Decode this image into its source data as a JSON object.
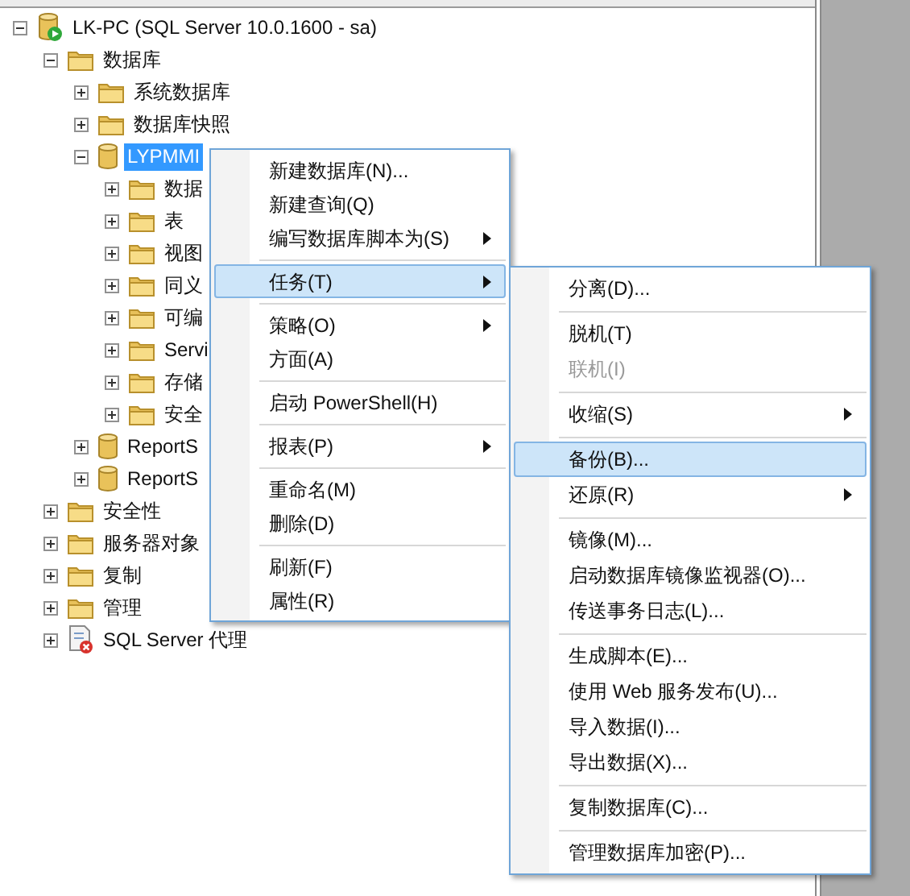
{
  "tree": [
    {
      "label": "LK-PC (SQL Server 10.0.1600 - sa)",
      "kind": "server",
      "expanded": true,
      "selected": false,
      "children": [
        {
          "label": "数据库",
          "kind": "folder",
          "expanded": true,
          "selected": false,
          "children": [
            {
              "label": "系统数据库",
              "kind": "folder",
              "expanded": false,
              "selected": false
            },
            {
              "label": "数据库快照",
              "kind": "folder",
              "expanded": false,
              "selected": false
            },
            {
              "label": "LYPMMI",
              "kind": "database",
              "expanded": true,
              "selected": true,
              "children": [
                {
                  "label": "数据",
                  "kind": "folder",
                  "expanded": false,
                  "selected": false
                },
                {
                  "label": "表",
                  "kind": "folder",
                  "expanded": false,
                  "selected": false
                },
                {
                  "label": "视图",
                  "kind": "folder",
                  "expanded": false,
                  "selected": false
                },
                {
                  "label": "同义",
                  "kind": "folder",
                  "expanded": false,
                  "selected": false
                },
                {
                  "label": "可编",
                  "kind": "folder",
                  "expanded": false,
                  "selected": false
                },
                {
                  "label": "Servi",
                  "kind": "folder",
                  "expanded": false,
                  "selected": false
                },
                {
                  "label": "存储",
                  "kind": "folder",
                  "expanded": false,
                  "selected": false
                },
                {
                  "label": "安全",
                  "kind": "folder",
                  "expanded": false,
                  "selected": false
                }
              ]
            },
            {
              "label": "ReportS",
              "kind": "database",
              "expanded": false,
              "selected": false
            },
            {
              "label": "ReportS",
              "kind": "database",
              "expanded": false,
              "selected": false
            }
          ]
        },
        {
          "label": "安全性",
          "kind": "folder",
          "expanded": false,
          "selected": false
        },
        {
          "label": "服务器对象",
          "kind": "folder",
          "expanded": false,
          "selected": false
        },
        {
          "label": "复制",
          "kind": "folder",
          "expanded": false,
          "selected": false
        },
        {
          "label": "管理",
          "kind": "folder",
          "expanded": false,
          "selected": false
        },
        {
          "label": "SQL Server 代理",
          "kind": "agent",
          "expanded": false,
          "selected": false
        }
      ]
    }
  ],
  "context_menu": {
    "items": [
      {
        "kind": "item",
        "label": "新建数据库(N)...",
        "submenu": false,
        "selected": false,
        "disabled": false
      },
      {
        "kind": "item",
        "label": "新建查询(Q)",
        "submenu": false,
        "selected": false,
        "disabled": false
      },
      {
        "kind": "item",
        "label": "编写数据库脚本为(S)",
        "submenu": true,
        "selected": false,
        "disabled": false
      },
      {
        "kind": "separator"
      },
      {
        "kind": "item",
        "label": "任务(T)",
        "submenu": true,
        "selected": true,
        "disabled": false
      },
      {
        "kind": "separator"
      },
      {
        "kind": "item",
        "label": "策略(O)",
        "submenu": true,
        "selected": false,
        "disabled": false
      },
      {
        "kind": "item",
        "label": "方面(A)",
        "submenu": false,
        "selected": false,
        "disabled": false
      },
      {
        "kind": "separator"
      },
      {
        "kind": "item",
        "label": "启动 PowerShell(H)",
        "submenu": false,
        "selected": false,
        "disabled": false
      },
      {
        "kind": "separator"
      },
      {
        "kind": "item",
        "label": "报表(P)",
        "submenu": true,
        "selected": false,
        "disabled": false
      },
      {
        "kind": "separator"
      },
      {
        "kind": "item",
        "label": "重命名(M)",
        "submenu": false,
        "selected": false,
        "disabled": false
      },
      {
        "kind": "item",
        "label": "删除(D)",
        "submenu": false,
        "selected": false,
        "disabled": false
      },
      {
        "kind": "separator"
      },
      {
        "kind": "item",
        "label": "刷新(F)",
        "submenu": false,
        "selected": false,
        "disabled": false
      },
      {
        "kind": "item",
        "label": "属性(R)",
        "submenu": false,
        "selected": false,
        "disabled": false
      }
    ]
  },
  "submenu": {
    "items": [
      {
        "kind": "item",
        "label": "分离(D)...",
        "submenu": false,
        "selected": false,
        "disabled": false
      },
      {
        "kind": "separator"
      },
      {
        "kind": "item",
        "label": "脱机(T)",
        "submenu": false,
        "selected": false,
        "disabled": false
      },
      {
        "kind": "item",
        "label": "联机(I)",
        "submenu": false,
        "selected": false,
        "disabled": true
      },
      {
        "kind": "separator"
      },
      {
        "kind": "item",
        "label": "收缩(S)",
        "submenu": true,
        "selected": false,
        "disabled": false
      },
      {
        "kind": "separator"
      },
      {
        "kind": "item",
        "label": "备份(B)...",
        "submenu": false,
        "selected": true,
        "disabled": false
      },
      {
        "kind": "item",
        "label": "还原(R)",
        "submenu": true,
        "selected": false,
        "disabled": false
      },
      {
        "kind": "separator"
      },
      {
        "kind": "item",
        "label": "镜像(M)...",
        "submenu": false,
        "selected": false,
        "disabled": false
      },
      {
        "kind": "item",
        "label": "启动数据库镜像监视器(O)...",
        "submenu": false,
        "selected": false,
        "disabled": false
      },
      {
        "kind": "item",
        "label": "传送事务日志(L)...",
        "submenu": false,
        "selected": false,
        "disabled": false
      },
      {
        "kind": "separator"
      },
      {
        "kind": "item",
        "label": "生成脚本(E)...",
        "submenu": false,
        "selected": false,
        "disabled": false
      },
      {
        "kind": "item",
        "label": "使用 Web 服务发布(U)...",
        "submenu": false,
        "selected": false,
        "disabled": false
      },
      {
        "kind": "item",
        "label": "导入数据(I)...",
        "submenu": false,
        "selected": false,
        "disabled": false
      },
      {
        "kind": "item",
        "label": "导出数据(X)...",
        "submenu": false,
        "selected": false,
        "disabled": false
      },
      {
        "kind": "separator"
      },
      {
        "kind": "item",
        "label": "复制数据库(C)...",
        "submenu": false,
        "selected": false,
        "disabled": false
      },
      {
        "kind": "separator"
      },
      {
        "kind": "item",
        "label": "管理数据库加密(P)...",
        "submenu": false,
        "selected": false,
        "disabled": false
      }
    ]
  }
}
